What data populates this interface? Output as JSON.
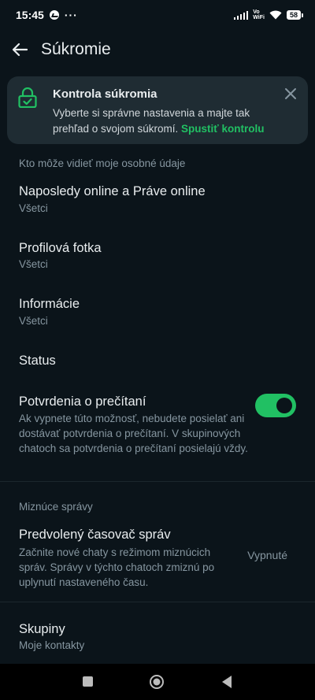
{
  "status_bar": {
    "time": "15:45",
    "dots": "···",
    "vowifi_top": "Vo",
    "vowifi_bottom": "WiFi",
    "battery": "58"
  },
  "app_bar": {
    "title": "Súkromie"
  },
  "privacy_card": {
    "title": "Kontrola súkromia",
    "text": "Vyberte si správne nastavenia a majte tak prehľad o svojom súkromí.",
    "link": "Spustiť kontrolu"
  },
  "section1": {
    "header": "Kto môže vidieť moje osobné údaje",
    "items": [
      {
        "title": "Naposledy online a Práve online",
        "value": "Všetci"
      },
      {
        "title": "Profilová fotka",
        "value": "Všetci"
      },
      {
        "title": "Informácie",
        "value": "Všetci"
      },
      {
        "title": "Status",
        "value": ""
      }
    ],
    "read_receipts": {
      "title": "Potvrdenia o prečítaní",
      "description": "Ak vypnete túto možnosť, nebudete posielať ani dostávať potvrdenia o prečítaní. V skupinových chatoch sa potvrdenia o prečítaní posielajú vždy.",
      "enabled": true
    }
  },
  "section2": {
    "header": "Miznúce správy",
    "timer": {
      "title": "Predvolený časovač správ",
      "description": "Začnite nové chaty s režimom miznúcich správ. Správy v týchto chatoch zmiznú po uplynutí nastaveného času.",
      "value": "Vypnuté"
    }
  },
  "groups": {
    "title": "Skupiny",
    "value": "Moje kontakty"
  },
  "colors": {
    "background": "#0b141a",
    "accent": "#21c063",
    "card": "#1f2c33"
  }
}
